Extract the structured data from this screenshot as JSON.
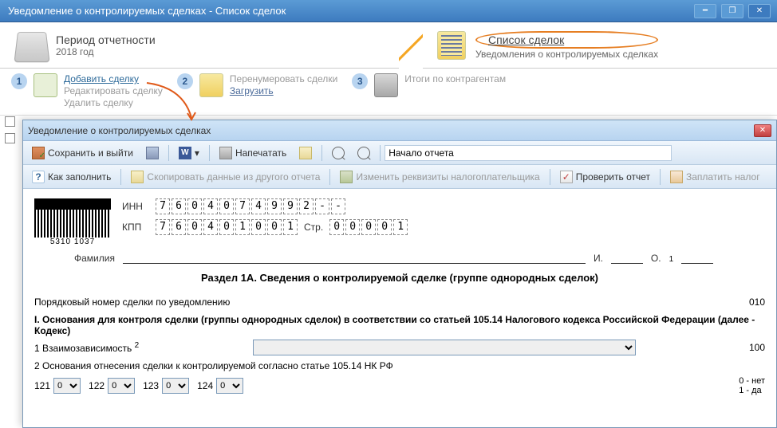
{
  "window": {
    "title": "Уведомление о контролируемых сделках - Список сделок"
  },
  "banner": {
    "period_title": "Период отчетности",
    "period_value": "2018 год",
    "list_title": "Список сделок",
    "list_sub": "Уведомления о контролируемых сделках"
  },
  "tabs": {
    "n1": "1",
    "add": "Добавить сделку",
    "edit": "Редактировать сделку",
    "del": "Удалить сделку",
    "n2": "2",
    "renum": "Перенумеровать сделки",
    "load": "Загрузить",
    "n3": "3",
    "totals": "Итоги по контрагентам"
  },
  "inner": {
    "title": "Уведомление о контролируемых сделках"
  },
  "tbar1": {
    "save_exit": "Сохранить и выйти",
    "word": "W",
    "print": "Напечатать",
    "search_ph": "Начало отчета"
  },
  "tbar2": {
    "howto": "Как заполнить",
    "copy": "Скопировать данные из другого отчета",
    "edit_req": "Изменить реквизиты налогоплательщика",
    "check": "Проверить отчет",
    "pay": "Заплатить налог"
  },
  "form": {
    "barcode_lbl": "5310 1037",
    "inn_lbl": "ИНН",
    "inn": [
      "7",
      "6",
      "0",
      "4",
      "0",
      "7",
      "4",
      "9",
      "9",
      "2",
      "-",
      "-"
    ],
    "kpp_lbl": "КПП",
    "kpp": [
      "7",
      "6",
      "0",
      "4",
      "0",
      "1",
      "0",
      "0",
      "1"
    ],
    "page_lbl": "Стр.",
    "page": [
      "0",
      "0",
      "0",
      "0",
      "1"
    ],
    "fam_lbl": "Фамилия",
    "i_lbl": "И.",
    "o_lbl": "О.",
    "sup1": "1",
    "section_title": "Раздел 1А. Сведения о контролируемой сделке (группе однородных сделок)",
    "order_lbl": "Порядковый номер сделки по уведомлению",
    "order_val": "010",
    "basis_title": "I. Основания для контроля сделки (группы однородных сделок) в соответствии со статьей 105.14 Налогового кодекса Российской Федерации (далее - Кодекс)",
    "interdep_lbl": "1 Взаимозависимость",
    "interdep_sup": "2",
    "interdep_val": "100",
    "grounds_lbl": "2 Основания отнесения сделки к контролируемой согласно статье 105.14 НК РФ",
    "c121": "121",
    "c122": "122",
    "c123": "123",
    "c124": "124",
    "opt0": "0",
    "legend0": "0 - нет",
    "legend1": "1 - да"
  }
}
